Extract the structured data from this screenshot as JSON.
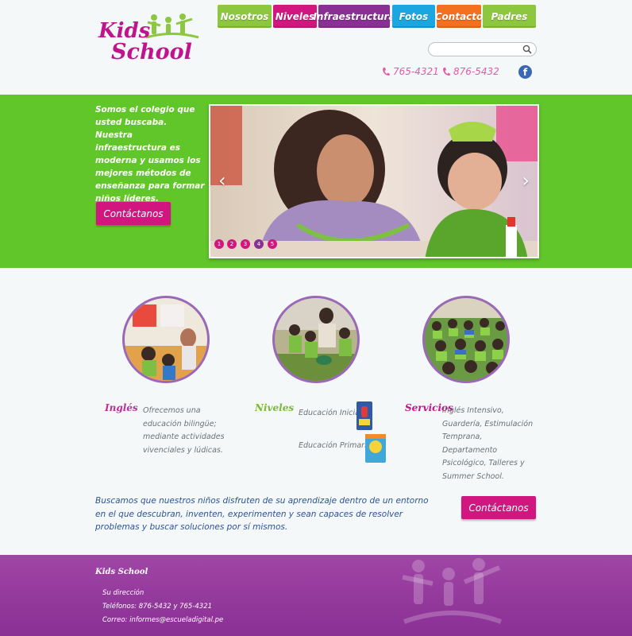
{
  "header": {
    "logo_line1": "Kids",
    "logo_line2": "School",
    "nav": [
      {
        "label": "Nosotros",
        "color": "#8dc73f"
      },
      {
        "label": "Niveles",
        "color": "#d1167f"
      },
      {
        "label": "Infraestructura",
        "color": "#8a2f94"
      },
      {
        "label": "Fotos",
        "color": "#1ba6df"
      },
      {
        "label": "Contacto",
        "color": "#f37021"
      },
      {
        "label": "Padres",
        "color": "#8dc73f"
      }
    ],
    "search_placeholder": "",
    "phone1": "765-4321",
    "phone2": "876-5432",
    "facebook_icon": "f"
  },
  "hero": {
    "text": "Somos el colegio que usted buscaba. Nuestra infraestructura es moderna y usamos los mejores métodos de enseñanza para formar niños líderes.",
    "cta": "Contáctanos",
    "dots": [
      "1",
      "2",
      "3",
      "4",
      "5"
    ],
    "prev_icon": "‹",
    "next_icon": "›"
  },
  "sections": {
    "ingles": {
      "title": "Inglés",
      "text": "Ofrecemos una educación bilingüe; mediante actividades vivenciales y lúdicas."
    },
    "niveles": {
      "title": "Niveles",
      "item1": "Educación Inicial",
      "item2": "Educación Primaria"
    },
    "servicios": {
      "title": "Servicios",
      "text": "Inglés Intensivo, Guardería, Estimulación Temprana, Departamento Psicológico, Talleres y Summer School."
    }
  },
  "mission": {
    "text": "Buscamos que nuestros niños disfruten de su aprendizaje dentro de un entorno en el que descubran, inventen, experimenten y sean capaces de resolver problemas y buscar soluciones por sí mismos.",
    "cta": "Contáctanos"
  },
  "footer": {
    "title": "Kids School",
    "address": "Su dirección",
    "phones": "Teléfonos: 876-5432 y 765-4321",
    "email": "Correo: informes@escueladigital.pe"
  }
}
